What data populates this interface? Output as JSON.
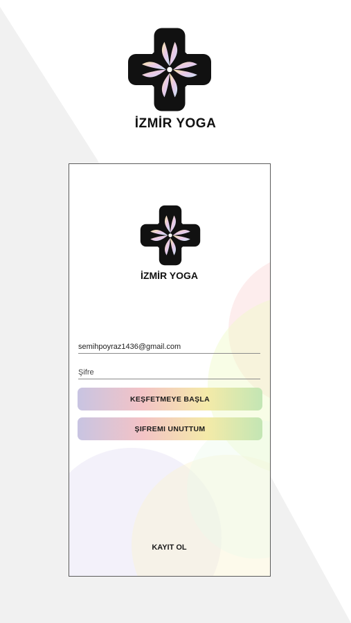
{
  "brand": {
    "name": "İZMİR YOGA"
  },
  "login": {
    "email_value": "semihpoyraz1436@gmail.com",
    "password_placeholder": "Şifre",
    "explore_button": "KEŞFETMEYE BAŞLA",
    "forgot_button": "ŞIFREMI UNUTTUM",
    "register_link": "KAYIT OL"
  },
  "colors": {
    "background": "#ffffff",
    "background_shape": "#f1f1f1",
    "gradient_start": "#c8c4e2",
    "gradient_mid": "#f3c3c6",
    "gradient_end": "#c3e6b4"
  },
  "icons": {
    "logo": "lotus-cross-logo-icon"
  }
}
